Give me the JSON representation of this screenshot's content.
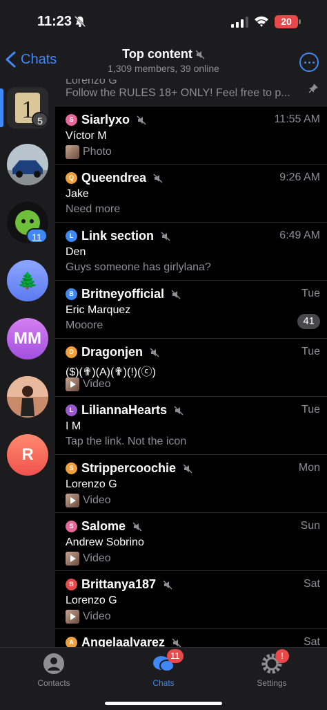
{
  "status_bar": {
    "time": "11:23",
    "battery": "20"
  },
  "header": {
    "back_label": "Chats",
    "title": "Top content",
    "subtitle": "1,309 members, 39 online"
  },
  "sidebar": {
    "items": [
      {
        "badge": "5",
        "avatar_text": "1"
      },
      {
        "badge": ""
      },
      {
        "badge": "11"
      },
      {
        "avatar_text": "🌲"
      },
      {
        "avatar_text": "MM"
      },
      {
        "badge": ""
      },
      {
        "avatar_text": "R"
      }
    ]
  },
  "pinned": {
    "sender_partial": "Lorenzo G",
    "message": "Follow the RULES 18+ ONLY! Feel free to p..."
  },
  "chats": [
    {
      "initial": "S",
      "color": "#e8689a",
      "name": "Siarlyxo",
      "time": "11:55 AM",
      "sender": "Víctor M",
      "preview": "Photo",
      "thumb": "photo",
      "unread": ""
    },
    {
      "initial": "Q",
      "color": "#f0a03c",
      "name": "Queendrea",
      "time": "9:26 AM",
      "sender": "Jake",
      "preview": "Need more",
      "thumb": "",
      "unread": ""
    },
    {
      "initial": "L",
      "color": "#3e88f7",
      "name": "Link section",
      "time": "6:49 AM",
      "sender": "Den",
      "preview": "Guys someone has girlylana?",
      "thumb": "",
      "unread": ""
    },
    {
      "initial": "B",
      "color": "#3e88f7",
      "name": "Britneyofficial",
      "time": "Tue",
      "sender": "Eric Marquez",
      "preview": "Mooore",
      "thumb": "",
      "unread": "41"
    },
    {
      "initial": "D",
      "color": "#f0a03c",
      "name": "Dragonjen",
      "time": "Tue",
      "sender": "($)(✟)(A)(✟)(!)(ⓒ)",
      "preview": "Video",
      "thumb": "video",
      "unread": ""
    },
    {
      "initial": "L",
      "color": "#9b59d0",
      "name": "LiliannaHearts",
      "time": "Tue",
      "sender": "I M",
      "preview": "Tap the link. Not the icon",
      "thumb": "",
      "unread": ""
    },
    {
      "initial": "S",
      "color": "#f0a03c",
      "name": "Strippercoochie",
      "time": "Mon",
      "sender": "Lorenzo G",
      "preview": "Video",
      "thumb": "video",
      "unread": ""
    },
    {
      "initial": "S",
      "color": "#e8689a",
      "name": "Salome",
      "time": "Sun",
      "sender": "Andrew Sobrino",
      "preview": "Video",
      "thumb": "video",
      "unread": ""
    },
    {
      "initial": "B",
      "color": "#e8494a",
      "name": "Brittanya187",
      "time": "Sat",
      "sender": "Lorenzo G",
      "preview": "Video",
      "thumb": "video",
      "unread": ""
    },
    {
      "initial": "A",
      "color": "#f0a03c",
      "name": "Angelaalvarez",
      "time": "Sat",
      "sender": "",
      "preview": "",
      "thumb": "",
      "unread": ""
    }
  ],
  "tabs": [
    {
      "label": "Contacts",
      "badge": ""
    },
    {
      "label": "Chats",
      "badge": "11"
    },
    {
      "label": "Settings",
      "badge": "!"
    }
  ],
  "colors": {
    "accent": "#3e88f7",
    "badge_red": "#e8494a",
    "muted_text": "#8e8e93"
  }
}
